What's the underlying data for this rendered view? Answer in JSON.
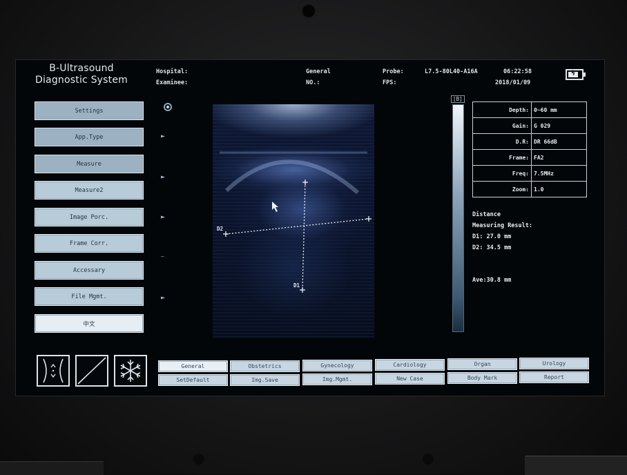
{
  "window": {
    "title_line1": "B-Ultrasound",
    "title_line2": "Diagnostic System"
  },
  "header": {
    "hospital_label": "Hospital:",
    "examinee_label": "Examinee:",
    "mode": "General",
    "no_label": "NO.:",
    "probe_label": "Probe:",
    "probe_value": "L7.5-80L40-A16A",
    "fps_label": "FPS:",
    "time": "06:22:58",
    "date": "2018/01/09",
    "battery_level": 0.75
  },
  "menu": {
    "items": [
      {
        "label": "Settings",
        "active": true
      },
      {
        "label": "App.Type",
        "active": true
      },
      {
        "label": "Measure",
        "active": true
      },
      {
        "label": "Measure2",
        "active": false
      },
      {
        "label": "Image Porc.",
        "active": false
      },
      {
        "label": "Frame Corr.",
        "active": false
      },
      {
        "label": "Accessary",
        "active": false
      },
      {
        "label": "File Mgmt.",
        "active": false
      },
      {
        "label": "中文",
        "active": false
      }
    ]
  },
  "side_icons": {
    "arrow_glyph": "►",
    "dash_glyph": "—"
  },
  "image": {
    "label_d1": "D1",
    "label_d2": "D2",
    "graybar_tag": "[B]"
  },
  "params": {
    "rows": [
      {
        "key": "Depth:",
        "value": "0~60 mm"
      },
      {
        "key": "Gain:",
        "value": "G 029"
      },
      {
        "key": "D.R:",
        "value": "DR 66dB"
      },
      {
        "key": "Frame:",
        "value": "FA2"
      },
      {
        "key": "Freq:",
        "value": "7.5MHz"
      },
      {
        "key": "Zoom:",
        "value": "1.0"
      }
    ]
  },
  "measurement": {
    "type": "Distance",
    "result_label": "Measuring Result:",
    "d1": "D1: 27.0 mm",
    "d2": "D2: 34.5 mm",
    "ave": "Ave:30.8 mm"
  },
  "tools": {
    "items": [
      "depth-adjust-icon",
      "diagonal-line-icon",
      "freeze-snowflake-icon"
    ]
  },
  "presets": {
    "row1": [
      "General",
      "Obstetrics",
      "Gynecology",
      "Cardiology",
      "Organ",
      "Urology"
    ],
    "row2": [
      "SetDefault",
      "Img.Save",
      "Img.Mgmt.",
      "New Case",
      "Body Mark",
      "Report"
    ]
  },
  "colors": {
    "screen_bg": "#030608",
    "button_bg": "#b8cbd8",
    "text": "#e7edf2"
  }
}
